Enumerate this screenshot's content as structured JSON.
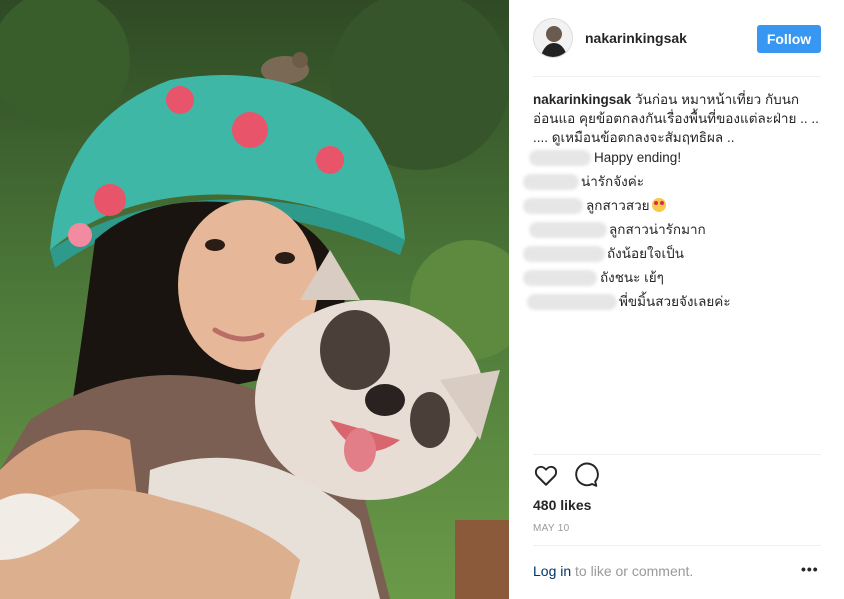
{
  "post": {
    "username": "nakarinkingsak",
    "follow_label": "Follow",
    "caption_user": "nakarinkingsak",
    "caption_text": " วันก่อน หมาหน้าเที่ยว กับนกอ่อนแอ คุยข้อตกลงกันเรื่องพื้นที่ของแต่ละฝ่าย .. .. .... ดูเหมือนข้อตกลงจะสัมฤทธิผล ..",
    "comments": [
      {
        "text": "Happy ending!",
        "emoji": false
      },
      {
        "text": "น่ารักจังค่ะ",
        "emoji": false
      },
      {
        "text": "ลูกสาวสวย",
        "emoji": true,
        "emoji_name": "heart-eyes-emoji"
      },
      {
        "text": "ลูกสาวน่ารักมาก",
        "emoji": false
      },
      {
        "text": "ถังน้อยใจเป็น",
        "emoji": false
      },
      {
        "text": "ถังชนะ เย้ๆ",
        "emoji": false
      },
      {
        "text": "พี่ขมิ้นสวยจังเลยค่ะ",
        "emoji": false
      }
    ],
    "likes": "480 likes",
    "date": "MAY 10",
    "login_link": "Log in",
    "login_rest": " to like or comment.",
    "more": "•••"
  },
  "icons": {
    "like": "heart-outline-icon",
    "comment": "speech-bubble-icon",
    "more": "more-options-icon"
  },
  "colors": {
    "follow_bg": "#3897f0",
    "link": "#003569",
    "muted": "#999999",
    "text": "#262626"
  }
}
